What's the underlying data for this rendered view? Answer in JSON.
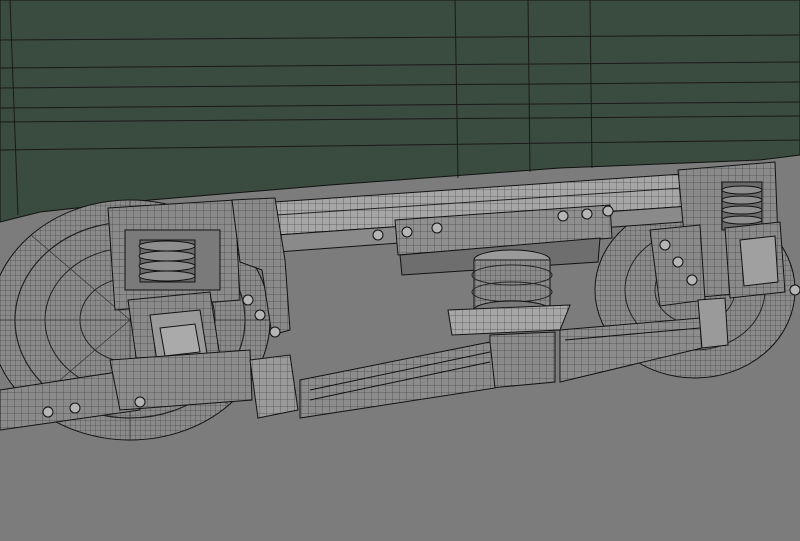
{
  "scene": {
    "subject": "wireframe-bogie-render",
    "colors": {
      "background": "#7c7c7c",
      "car_body": "#3a4b3f",
      "wire": "#111111",
      "metal": "#8a8a8a",
      "metal_dark": "#5f5f5f",
      "metal_light": "#a6a6a6"
    },
    "icons": [
      "wheel",
      "coil-spring",
      "axle-box",
      "air-spring",
      "leaf-spring",
      "bolt"
    ]
  }
}
